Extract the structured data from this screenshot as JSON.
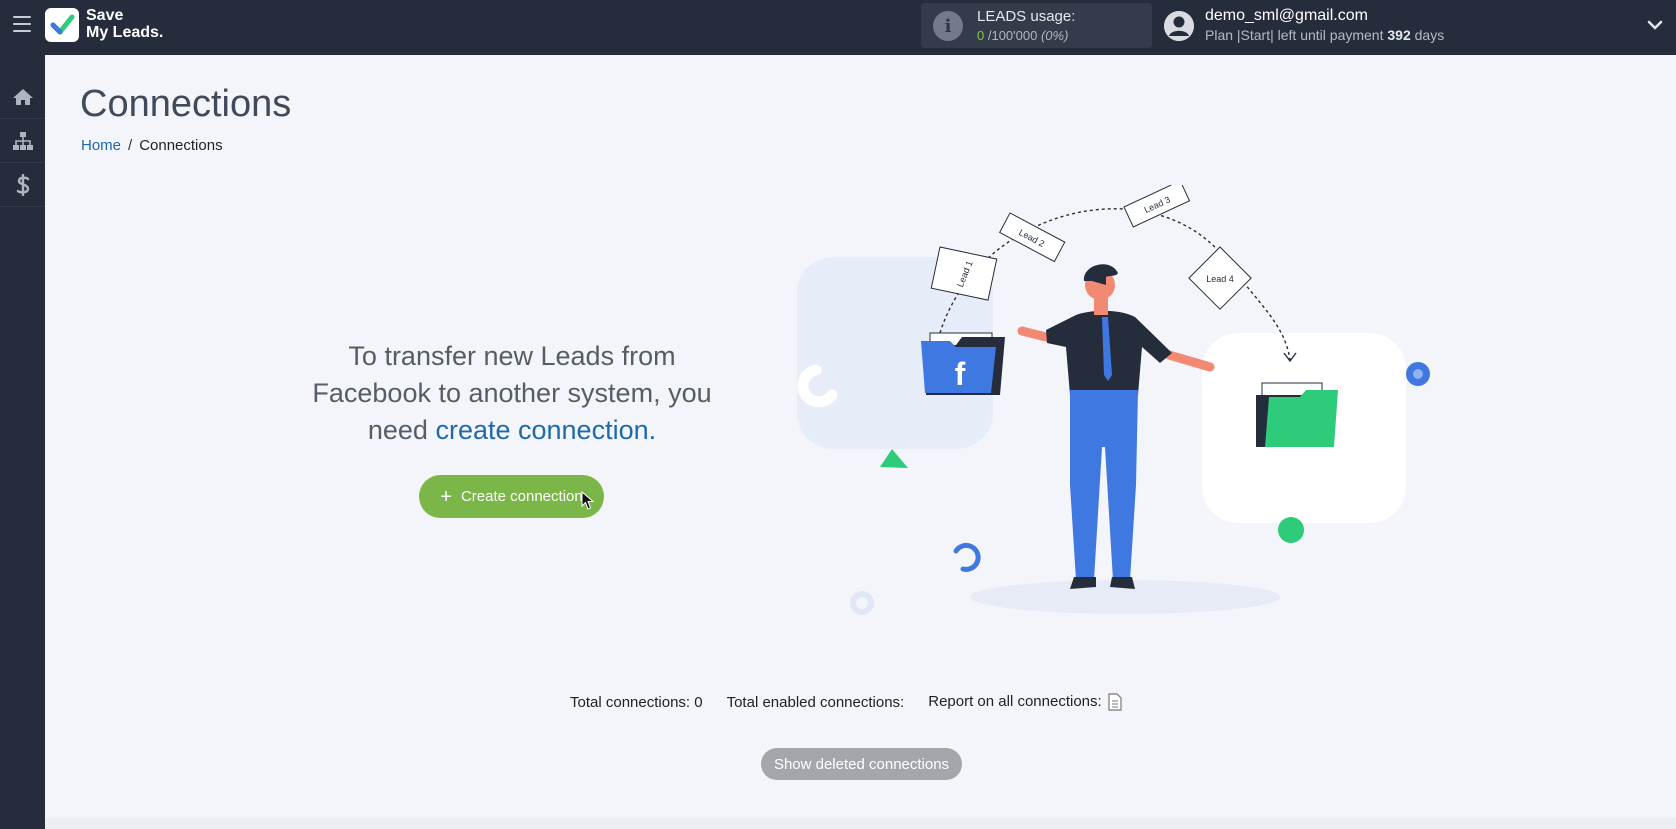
{
  "topbar": {
    "logo": {
      "line1": "Save",
      "line2": "My Leads."
    },
    "usage": {
      "title": "LEADS usage:",
      "used": "0",
      "limit": "/100'000",
      "percent": "(0%)"
    },
    "user": {
      "email": "demo_sml@gmail.com",
      "plan_prefix": "Plan |Start| left until payment",
      "days_value": "392",
      "days_suffix": "days"
    }
  },
  "sidebar": {
    "items": [
      {
        "name": "home",
        "icon": "home-icon"
      },
      {
        "name": "connections",
        "icon": "sitemap-icon"
      },
      {
        "name": "billing",
        "icon": "dollar-icon"
      }
    ]
  },
  "main": {
    "title": "Connections",
    "breadcrumb": {
      "home": "Home",
      "separator": "/",
      "current": "Connections"
    },
    "promo": {
      "line1": "To transfer new Leads from",
      "line2": "Facebook to another system, you",
      "line3_prefix": "need",
      "link": "create connection",
      "line3_suffix": "."
    },
    "create_button": {
      "plus": "+",
      "label": "Create connection"
    },
    "illustration": {
      "lead_labels": [
        "Lead 1",
        "Lead 2",
        "Lead 3",
        "Lead 4"
      ],
      "source_letter": "f"
    },
    "stats": {
      "total_label": "Total connections:",
      "total_value": "0",
      "enabled_label": "Total enabled connections:",
      "enabled_value": "",
      "report_label": "Report on all connections:"
    },
    "deleted_button": "Show deleted connections"
  },
  "colors": {
    "topbar": "#252d3c",
    "background": "#f3f5fb",
    "accent_green": "#7ab648",
    "link_blue": "#1f6aa9",
    "illustration_blue": "#3f78e0",
    "illustration_green": "#2ecc7a"
  }
}
